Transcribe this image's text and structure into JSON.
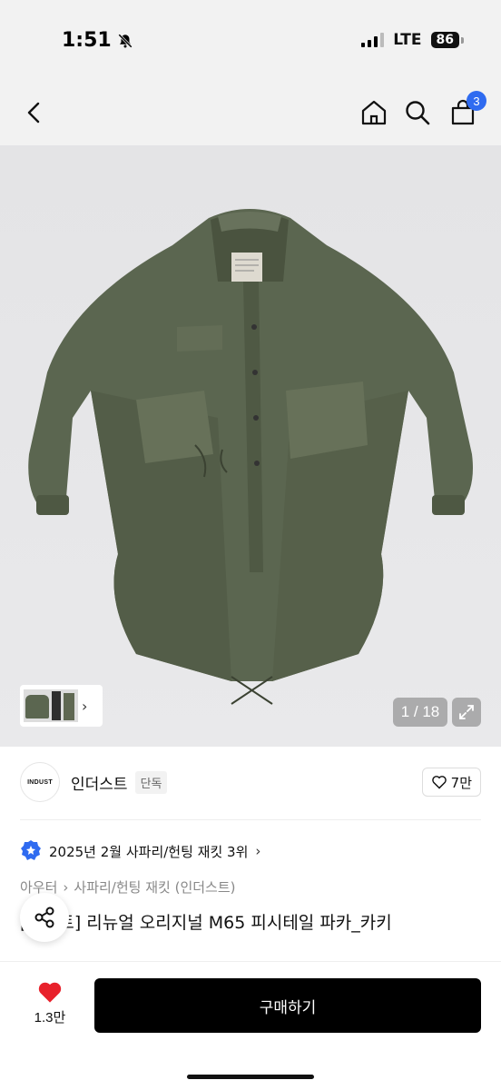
{
  "status_bar": {
    "time": "1:51",
    "network": "LTE",
    "battery": "86"
  },
  "nav": {
    "cart_count": "3"
  },
  "gallery": {
    "counter": "1 / 18"
  },
  "seller": {
    "logo_text": "INDUST",
    "name": "인더스트",
    "badge": "단독",
    "likes": "7만"
  },
  "ranking": {
    "text": "2025년 2월 사파리/헌팅 재킷 3위"
  },
  "breadcrumb": {
    "level1": "아우터",
    "level2": "사파리/헌팅 재킷 (인더스트)"
  },
  "product": {
    "title": "[더세트] 리뉴얼 오리지널 M65 피시테일 파카_카키"
  },
  "bottom": {
    "wish_count": "1.3만",
    "buy_label": "구매하기"
  },
  "colors": {
    "accent_badge": "#2f6bf0",
    "heart": "#e8212b",
    "jacket": "#5b6650"
  }
}
